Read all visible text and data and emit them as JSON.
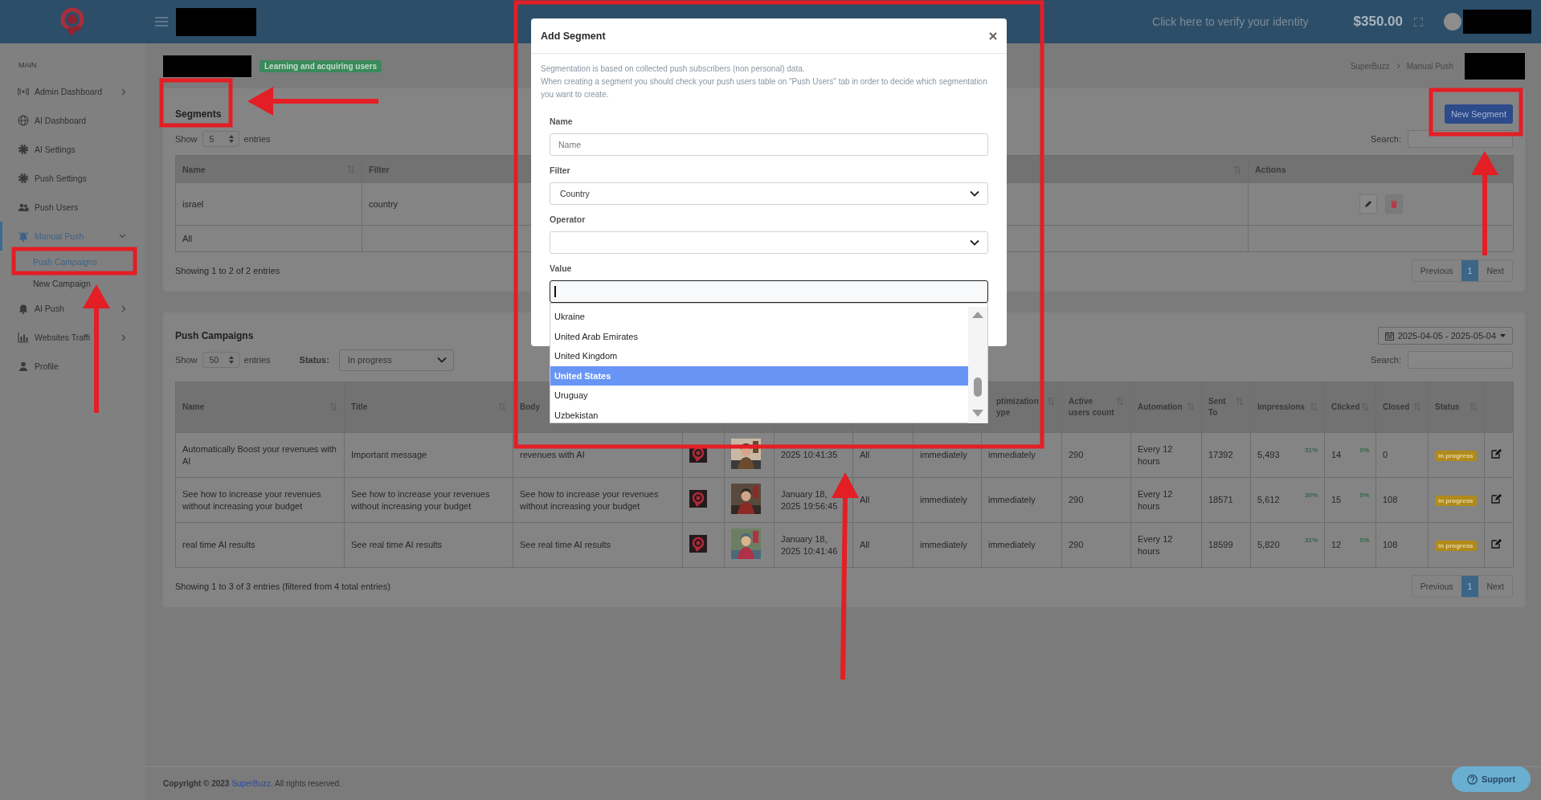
{
  "topbar": {
    "verify_link": "Click here to verify your identity",
    "balance": "$350.00"
  },
  "sidebar": {
    "heading": "MAIN",
    "items": [
      {
        "label": "Admin Dashboard",
        "kind": "group",
        "expanded": false,
        "selected": false
      },
      {
        "label": "AI Dashboard",
        "kind": "link",
        "selected": false
      },
      {
        "label": "AI Settings",
        "kind": "link",
        "selected": false
      },
      {
        "label": "Push Settings",
        "kind": "link",
        "selected": false
      },
      {
        "label": "Push Users",
        "kind": "link",
        "selected": false
      },
      {
        "label": "Manual Push",
        "kind": "group",
        "expanded": true,
        "selected": true,
        "children": [
          {
            "label": "Push Campaigns",
            "selected": true
          },
          {
            "label": "New Campaign",
            "selected": false
          }
        ]
      },
      {
        "label": "AI Push",
        "kind": "group",
        "expanded": false,
        "selected": false
      },
      {
        "label": "Websites Traffi",
        "kind": "group",
        "expanded": false,
        "selected": false
      },
      {
        "label": "Profile",
        "kind": "link",
        "selected": false
      }
    ]
  },
  "page_header": {
    "badge": "Learning and acquiring users",
    "breadcrumb": [
      "SuperBuzz",
      "Manual Push"
    ]
  },
  "segments": {
    "title": "Segments",
    "new_button": "New Segment",
    "show_label": "Show",
    "page_size": "5",
    "entries_label": "entries",
    "search_label": "Search:",
    "columns": [
      {
        "label": "Name",
        "sortable": true
      },
      {
        "label": "Filter"
      },
      {
        "sortable": true
      },
      {
        "label": "Actions",
        "sortable": false
      }
    ],
    "rows": [
      {
        "cells": [
          "israel",
          "country"
        ],
        "has_actions": true
      },
      {
        "cells": [
          "All"
        ],
        "has_actions": false
      }
    ],
    "info": "Showing 1 to 2 of 2 entries",
    "pagination": {
      "previous": {
        "label": "Previous",
        "disabled": true
      },
      "pages": [
        {
          "label": "1",
          "selected": true
        }
      ],
      "next": {
        "label": "Next",
        "disabled": true
      }
    }
  },
  "campaigns": {
    "title": "Push Campaigns",
    "date_range": "2025-04-05 - 2025-05-04",
    "show_label": "Show",
    "page_size": "50",
    "entries_label": "entries",
    "status_label": "Status:",
    "status_value": "In progress",
    "search_label": "Search:",
    "columns": [
      {
        "label": "Name",
        "sortable": true
      },
      {
        "label": "Title",
        "sortable": true
      },
      {
        "label": "Body"
      },
      null,
      null,
      null,
      null,
      null,
      {
        "label": "ptimization ype",
        "sortable": true
      },
      {
        "label": "Active users count",
        "sortable": true
      },
      {
        "label": "Automation",
        "sortable": true
      },
      {
        "label": "Sent To",
        "sortable": true
      },
      {
        "label": "Impressions",
        "sortable": true
      },
      {
        "label": "Clicked",
        "sortable": true
      },
      {
        "label": "Closed",
        "sortable": true
      },
      {
        "label": "Status",
        "sortable": true
      },
      {
        "sortable": false
      }
    ],
    "rows": [
      {
        "name": "Automatically Boost your revenues with AI",
        "title": "Important message",
        "body": "revenues with AI",
        "date": "2025 10:41:35",
        "segment": "All",
        "delivery": "immediately",
        "optimization": "immediately",
        "active_users": "290",
        "automation": "Every 12 hours",
        "sent_to": "17392",
        "impressions": "5,493",
        "impressions_rate": "31%",
        "clicked": "14",
        "clicked_rate": "0%",
        "closed": "0",
        "status": "in progress"
      },
      {
        "name": "See how to increase your revenues without increasing your budget",
        "title": "See how to increase your revenues without increasing your budget",
        "body": "See how to increase your revenues without increasing your budget",
        "date": "January 18, 2025 19:56:45",
        "segment": "All",
        "delivery": "immediately",
        "optimization": "immediately",
        "active_users": "290",
        "automation": "Every 12 hours",
        "sent_to": "18571",
        "impressions": "5,612",
        "impressions_rate": "30%",
        "clicked": "15",
        "clicked_rate": "0%",
        "closed": "108",
        "status": "in progress"
      },
      {
        "name": "real time AI results",
        "title": "See real time AI results",
        "body": "See real time AI results",
        "date": "January 18, 2025 10:41:46",
        "segment": "All",
        "delivery": "immediately",
        "optimization": "immediately",
        "active_users": "290",
        "automation": "Every 12 hours",
        "sent_to": "18599",
        "impressions": "5,820",
        "impressions_rate": "31%",
        "clicked": "12",
        "clicked_rate": "0%",
        "closed": "108",
        "status": "in progress"
      }
    ],
    "info": "Showing 1 to 3 of 3 entries (filtered from 4 total entries)",
    "pagination": {
      "previous": {
        "label": "Previous",
        "disabled": true
      },
      "pages": [
        {
          "label": "1",
          "selected": true
        }
      ],
      "next": {
        "label": "Next",
        "disabled": true
      }
    }
  },
  "modal": {
    "title": "Add Segment",
    "description": [
      "Segmentation is based on collected push subscribers (non personal) data.",
      "When creating a segment you should check your push users table on \"Push Users\" tab in order to decide which segmentation you want to create."
    ],
    "fields": [
      {
        "kind": "text",
        "label": "Name",
        "placeholder": "Name"
      },
      {
        "kind": "select",
        "label": "Filter",
        "value": "Country"
      },
      {
        "kind": "select",
        "label": "Operator"
      },
      {
        "kind": "combo",
        "label": "Value",
        "focused": true,
        "options": [
          {
            "label": "Ukraine",
            "selected": false
          },
          {
            "label": "United Arab Emirates",
            "selected": false
          },
          {
            "label": "United Kingdom",
            "selected": false
          },
          {
            "label": "United States",
            "selected": true
          },
          {
            "label": "Uruguay",
            "selected": false
          },
          {
            "label": "Uzbekistan",
            "selected": false
          }
        ]
      }
    ]
  },
  "footer": {
    "prefix": "Copyright © 2023",
    "link": "SuperBuzz",
    "suffix": ". All rights reserved."
  },
  "support_button": "Support"
}
